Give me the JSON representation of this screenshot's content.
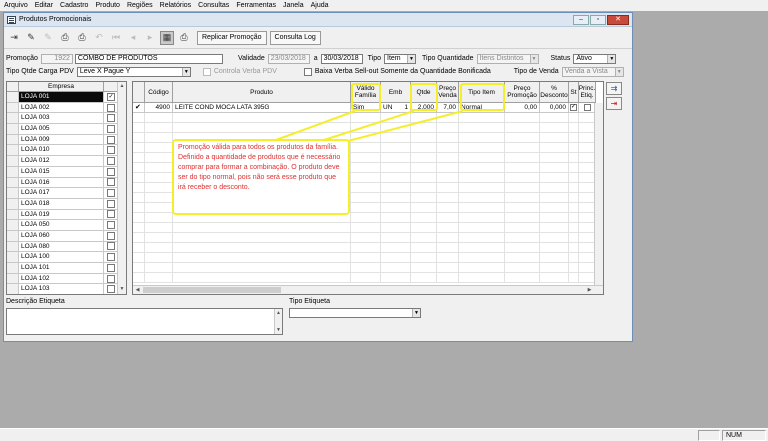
{
  "menu": [
    "Arquivo",
    "Editar",
    "Cadastro",
    "Produto",
    "Regiões",
    "Relatórios",
    "Consultas",
    "Ferramentas",
    "Janela",
    "Ajuda"
  ],
  "window": {
    "title": "Produtos Promocionais"
  },
  "toolbar": {
    "replicar_label": "Replicar Promoção",
    "consulta_log_label": "Consulta Log"
  },
  "form": {
    "promocao_label": "Promoção",
    "promocao_code": "1922",
    "promocao_name": "COMBO DE PRODUTOS",
    "validade_label": "Validade",
    "validade_from": "23/03/2018",
    "validade_to_label": "a",
    "validade_to": "30/03/2018",
    "tipo_label": "Tipo",
    "tipo_value": "Item",
    "tipo_quantidade_label": "Tipo Quantidade",
    "tipo_quantidade_value": "Itens Distintos",
    "status_label": "Status",
    "status_value": "Ativo",
    "tipo_qtde_label": "Tipo Qtde Carga PDV",
    "tipo_qtde_value": "Leve X Pague Y",
    "controla_verba_label": "Controla Verba PDV",
    "baixa_verba_label": "Baixa Verba Sell-out Somente da Quantidade Bonificada",
    "tipo_venda_label": "Tipo de Venda",
    "tipo_venda_value": "Venda a Vista"
  },
  "empresa": {
    "header": "Empresa",
    "rows": [
      {
        "name": "LOJA 001",
        "checked": true
      },
      {
        "name": "LOJA 002",
        "checked": false
      },
      {
        "name": "LOJA 003",
        "checked": false
      },
      {
        "name": "LOJA 005",
        "checked": false
      },
      {
        "name": "LOJA 009",
        "checked": false
      },
      {
        "name": "LOJA 010",
        "checked": false
      },
      {
        "name": "LOJA 012",
        "checked": false
      },
      {
        "name": "LOJA 015",
        "checked": false
      },
      {
        "name": "LOJA 016",
        "checked": false
      },
      {
        "name": "LOJA 017",
        "checked": false
      },
      {
        "name": "LOJA 018",
        "checked": false
      },
      {
        "name": "LOJA 019",
        "checked": false
      },
      {
        "name": "LOJA 050",
        "checked": false
      },
      {
        "name": "LOJA 060",
        "checked": false
      },
      {
        "name": "LOJA 080",
        "checked": false
      },
      {
        "name": "LOJA 100",
        "checked": false
      },
      {
        "name": "LOJA 101",
        "checked": false
      },
      {
        "name": "LOJA 102",
        "checked": false
      },
      {
        "name": "LOJA 103",
        "checked": false
      }
    ]
  },
  "produtos": {
    "headers": {
      "codigo": "Código",
      "produto": "Produto",
      "valido_familia": "Válido Família",
      "emb": "Emb",
      "qtde": "Qtde",
      "preco_venda": "Preço Venda",
      "tipo_item": "Tipo Item",
      "preco_promocao": "Preço Promoção",
      "desconto": "% Desconto",
      "st": "St",
      "princ_etiq": "Princ. Etiq."
    },
    "row": {
      "codigo": "4900",
      "produto": "LEITE COND MOCA LATA 395G",
      "valido_familia": "Sim",
      "emb": "UN",
      "emb_qty": "1",
      "qtde": "2,000",
      "preco_venda": "7,00",
      "tipo_item": "Normal",
      "preco_promocao": "0,00",
      "desconto": "0,000"
    }
  },
  "callout": {
    "text": "Promoção válida para todos os produtos da família. Definido a quantidade de produtos que é necessário comprar para formar a combinação. O produto deve ser do tipo normal, pois não será esse produto que irá receber o desconto."
  },
  "bottom": {
    "descricao_label": "Descrição Etiqueta",
    "tipo_etiqueta_label": "Tipo Etiqueta"
  },
  "statusbar": {
    "num": "NUM"
  },
  "colors": {
    "highlight": "#f5ee2a",
    "annotation_text": "#e03030"
  }
}
